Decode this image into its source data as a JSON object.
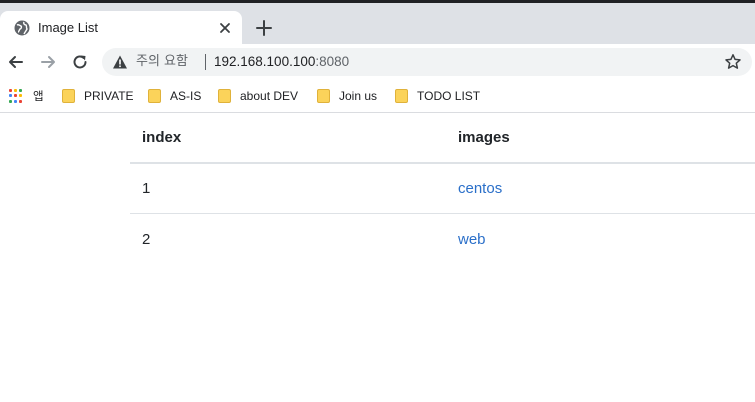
{
  "browser": {
    "tab": {
      "title": "Image List",
      "favicon": "globe-icon"
    },
    "new_tab_icon": "plus-icon",
    "omnibox": {
      "warning_label": "주의 요함",
      "url_host": "192.168.100.100",
      "url_port": ":8080",
      "bookmark_icon": "star-icon"
    },
    "bookmarks": {
      "apps_label": "앱",
      "items": [
        {
          "label": "PRIVATE",
          "icon": "folder-icon"
        },
        {
          "label": "AS-IS",
          "icon": "folder-icon"
        },
        {
          "label": "about DEV",
          "icon": "folder-icon"
        },
        {
          "label": "Join us",
          "icon": "folder-icon"
        },
        {
          "label": "TODO LIST",
          "icon": "folder-icon"
        }
      ]
    }
  },
  "table": {
    "headers": {
      "index": "index",
      "images": "images"
    },
    "rows": [
      {
        "index": "1",
        "image": "centos"
      },
      {
        "index": "2",
        "image": "web"
      }
    ]
  },
  "colors": {
    "link": "#2a6fc9",
    "folder": "#fbd35a",
    "tabstrip": "#dee1e6",
    "omnibox": "#f1f3f4"
  }
}
